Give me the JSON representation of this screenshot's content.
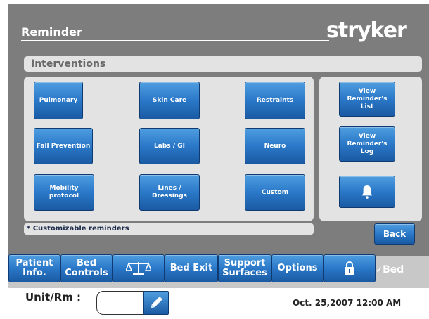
{
  "header": {
    "title": "Reminder",
    "brand": "stryker"
  },
  "section": {
    "title": "Interventions"
  },
  "interventions": [
    {
      "label": "Pulmonary"
    },
    {
      "label": "Skin Care"
    },
    {
      "label": "Restraints"
    },
    {
      "label": "Fall Prevention"
    },
    {
      "label": "Labs / GI"
    },
    {
      "label": "Neuro"
    },
    {
      "label": "Mobility\nprotocol"
    },
    {
      "label": "Lines /\nDressings"
    },
    {
      "label": "Custom"
    }
  ],
  "side_actions": {
    "view_list": "View\nReminder's\nList",
    "view_log": "View\nReminder's\nLog",
    "bell_icon": "bell-icon"
  },
  "note": "* Customizable reminders",
  "back": "Back",
  "nav": {
    "patient_info": "Patient\nInfo.",
    "bed_controls": "Bed\nControls",
    "scale_icon": "scale-icon",
    "bed_exit": "Bed Exit",
    "support_surfaces": "Support\nSurfaces",
    "options": "Options",
    "lock_icon": "lock-icon",
    "sbed": "Bed"
  },
  "footer": {
    "unit_label": "Unit/Rm :",
    "unit_value": "",
    "datetime": "Oct. 25,2007  12:00 AM"
  },
  "colors": {
    "button_blue": "#2a78c8",
    "header_gray": "#7d7d7d",
    "panel_gray": "#e3e3e3"
  }
}
